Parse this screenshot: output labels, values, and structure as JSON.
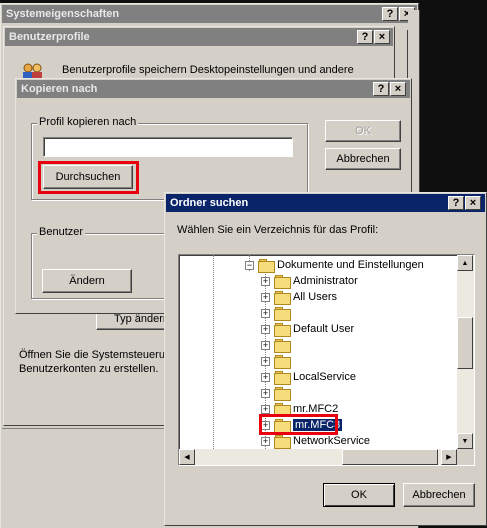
{
  "sysprops": {
    "title": "Systemeigenschaften",
    "help": "?",
    "close": "×"
  },
  "profiles": {
    "title": "Benutzerprofile",
    "help": "?",
    "close": "×",
    "description": "Benutzerprofile speichern Desktopeinstellungen und andere",
    "partial_button": "Typ ändern",
    "hint_line1": "Öffnen Sie die Systemsteuerung",
    "hint_line2": "Benutzerkonten zu erstellen."
  },
  "copy_dialog": {
    "title": "Kopieren nach",
    "help": "?",
    "close": "×",
    "group_copy_label": "Profil kopieren nach",
    "path_value": "",
    "browse_label": "Durchsuchen",
    "ok_label": "OK",
    "cancel_label": "Abbrechen",
    "group_user_label": "Benutzer",
    "change_label": "Ändern"
  },
  "browse_dialog": {
    "title": "Ordner suchen",
    "help": "?",
    "close": "×",
    "prompt": "Wählen Sie ein Verzeichnis für das Profil:",
    "tree": [
      {
        "label": "Dokumente und Einstellungen",
        "expander": "−",
        "level": 0
      },
      {
        "label": "Administrator",
        "expander": "+",
        "level": 1
      },
      {
        "label": "All Users",
        "expander": "+",
        "level": 1
      },
      {
        "label": "",
        "expander": "+",
        "level": 1
      },
      {
        "label": "Default User",
        "expander": "+",
        "level": 1
      },
      {
        "label": "",
        "expander": "+",
        "level": 1
      },
      {
        "label": "",
        "expander": "+",
        "level": 1
      },
      {
        "label": "LocalService",
        "expander": "+",
        "level": 1
      },
      {
        "label": "",
        "expander": "+",
        "level": 1
      },
      {
        "label": "mr.MFC2",
        "expander": "+",
        "level": 1
      },
      {
        "label": "mr.MFC3",
        "expander": "+",
        "level": 1,
        "selected": true
      },
      {
        "label": "NetworkService",
        "expander": "+",
        "level": 1
      }
    ],
    "ok_label": "OK",
    "cancel_label": "Abbrechen"
  },
  "colors": {
    "highlight_red": "#e8000e",
    "selection": "#0a246a",
    "face": "#d4d0c8"
  }
}
